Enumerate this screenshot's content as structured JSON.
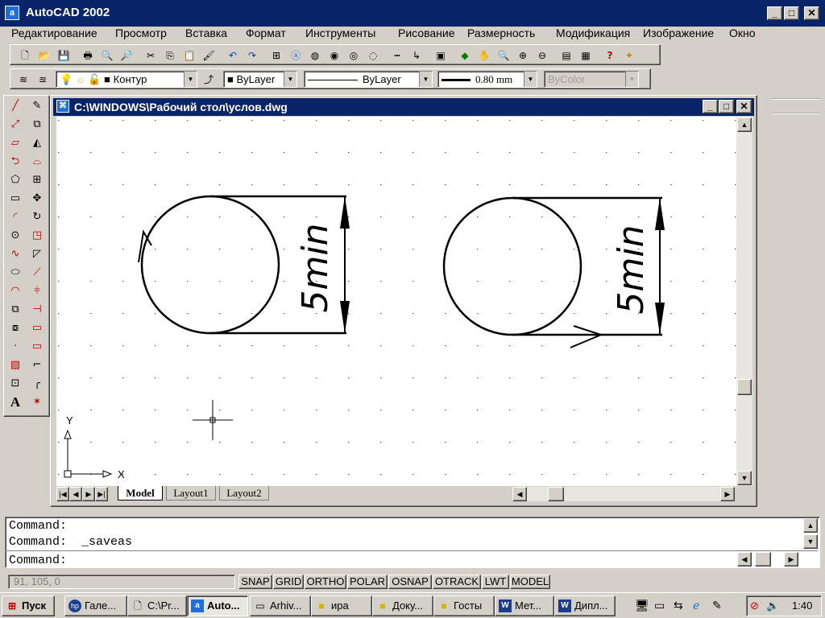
{
  "app": {
    "title": "AutoCAD 2002",
    "icon": "autocad-app-icon"
  },
  "menu": [
    "Редактирование",
    "Просмотр",
    "Вставка",
    "Формат",
    "Инструменты",
    "Рисование",
    "Размерность",
    "Модификация",
    "Изображение",
    "Окно"
  ],
  "properties": {
    "layer": "Контур",
    "color": "ByLayer",
    "linetype": "ByLayer",
    "lineweight": "0.80 mm",
    "plotstyle": "ByColor"
  },
  "document": {
    "title": "C:\\WINDOWS\\Рабочий стол\\услов.dwg",
    "dimension_text": "5min",
    "ucs": {
      "x_label": "X",
      "y_label": "Y"
    },
    "tabs": [
      "Model",
      "Layout1",
      "Layout2"
    ]
  },
  "command": {
    "lines": [
      "Command:",
      "Command:  _saveas",
      "Command:"
    ]
  },
  "status": {
    "coords": "91, 105, 0",
    "toggles": [
      "SNAP",
      "GRID",
      "ORTHO",
      "POLAR",
      "OSNAP",
      "OTRACK",
      "LWT",
      "MODEL"
    ]
  },
  "taskbar": {
    "start": "Пуск",
    "tasks": [
      {
        "label": "Гале...",
        "icon": "hp-icon"
      },
      {
        "label": "C:\\Pr...",
        "icon": "document-icon"
      },
      {
        "label": "Auto...",
        "icon": "autocad-icon"
      },
      {
        "label": "Arhiv...",
        "icon": "drive-icon"
      },
      {
        "label": "ира",
        "icon": "folder-icon"
      },
      {
        "label": "Доку...",
        "icon": "folder-icon"
      },
      {
        "label": "Госты",
        "icon": "folder-icon"
      },
      {
        "label": "Мет...",
        "icon": "word-icon"
      },
      {
        "label": "Дипл...",
        "icon": "word-icon"
      }
    ],
    "clock": "1:40"
  },
  "colors": {
    "titlebar": "#0a246a",
    "face": "#d4d0c8",
    "canvas": "#ffffff"
  }
}
